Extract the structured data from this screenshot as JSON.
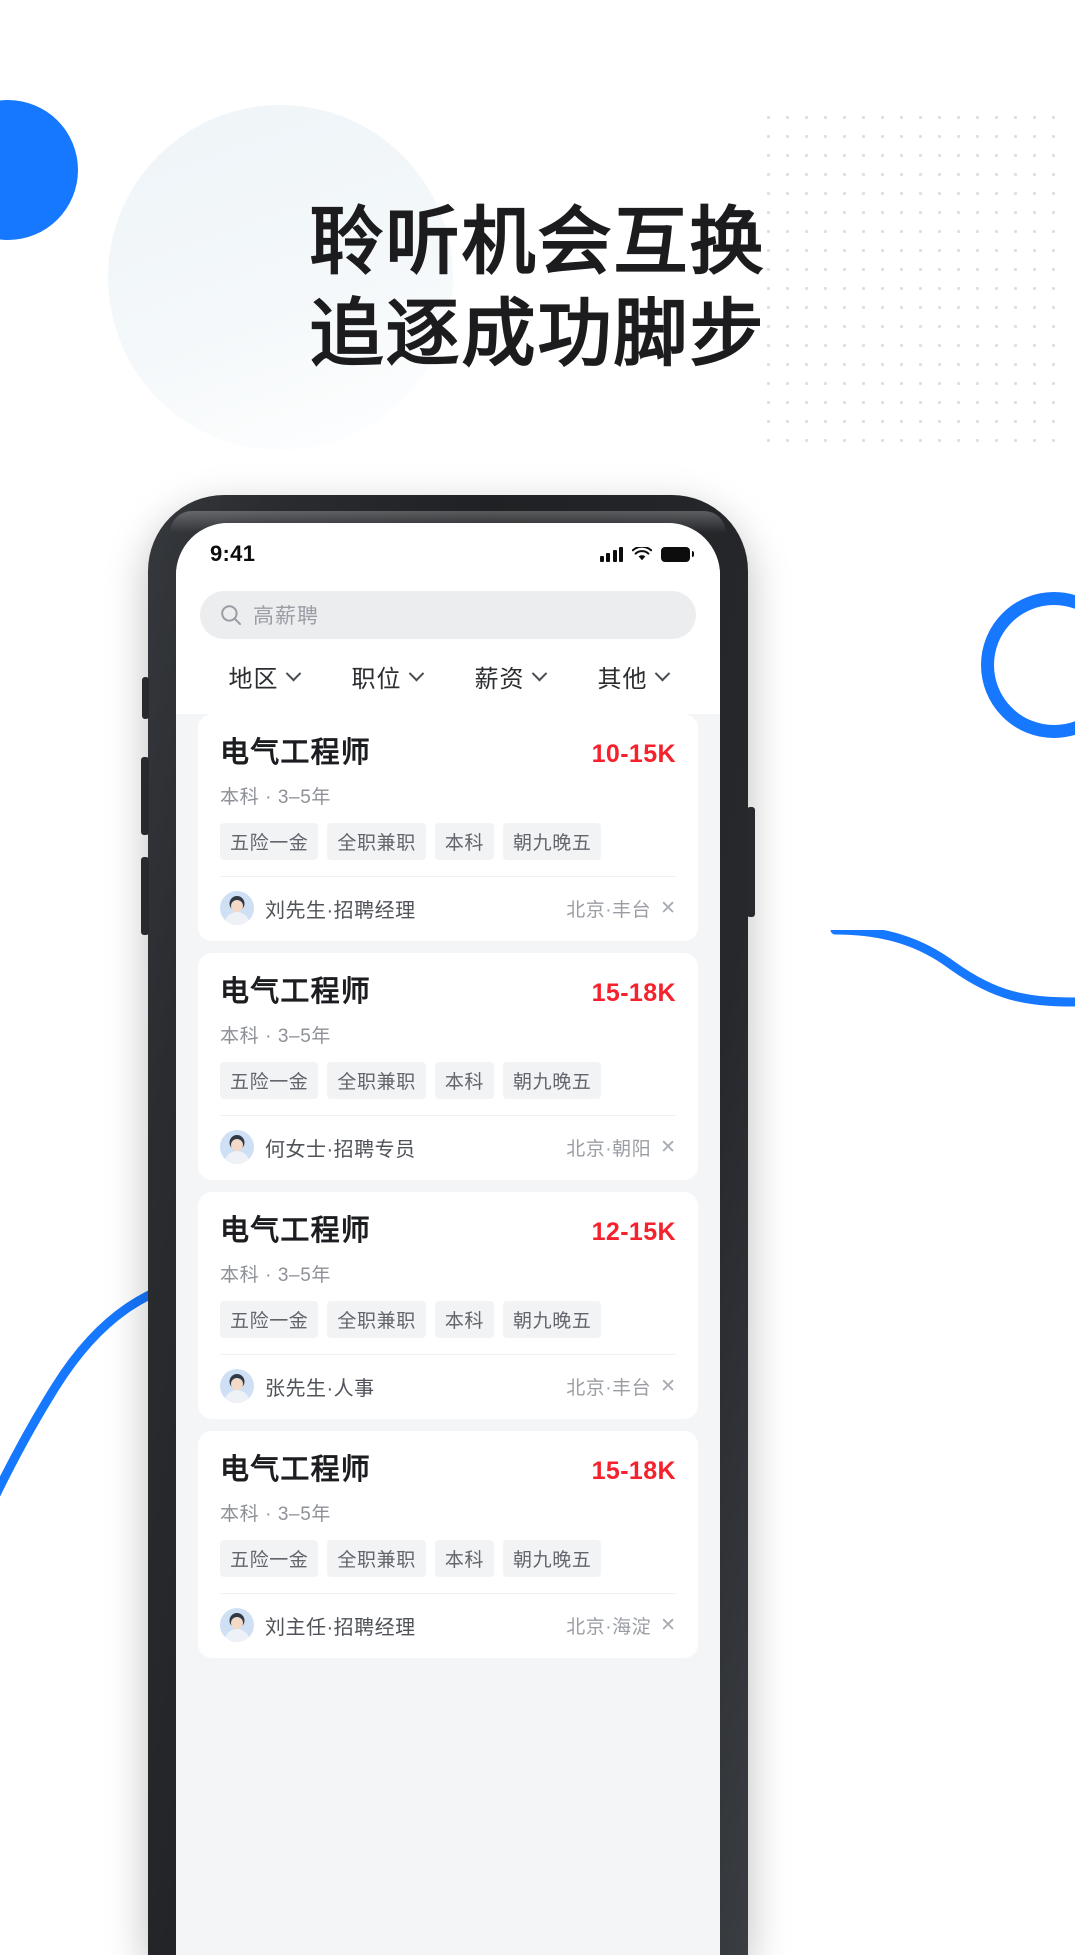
{
  "headline": {
    "line1": "聆听机会互换",
    "line2": "追逐成功脚步"
  },
  "colors": {
    "accent_blue": "#1677ff",
    "salary_red": "#f5222d",
    "text_dark": "#1c1c1e",
    "muted": "#9a9ea4"
  },
  "phone": {
    "statusbar": {
      "time": "9:41",
      "signal_icon": "cellular-signal-icon",
      "wifi_icon": "wifi-icon",
      "battery_icon": "battery-icon"
    },
    "search": {
      "icon": "search-icon",
      "placeholder": "高薪聘",
      "value": ""
    },
    "filters": [
      {
        "label": "地区",
        "icon": "chevron-down-icon"
      },
      {
        "label": "职位",
        "icon": "chevron-down-icon"
      },
      {
        "label": "薪资",
        "icon": "chevron-down-icon"
      },
      {
        "label": "其他",
        "icon": "chevron-down-icon"
      }
    ],
    "jobs": [
      {
        "title": "电气工程师",
        "salary": "10-15K",
        "meta": "本科 · 3–5年",
        "tags": [
          "五险一金",
          "全职兼职",
          "本科",
          "朝九晚五"
        ],
        "recruiter": "刘先生·招聘经理",
        "location": "北京·丰台",
        "close_icon": "close-icon"
      },
      {
        "title": "电气工程师",
        "salary": "15-18K",
        "meta": "本科 · 3–5年",
        "tags": [
          "五险一金",
          "全职兼职",
          "本科",
          "朝九晚五"
        ],
        "recruiter": "何女士·招聘专员",
        "location": "北京·朝阳",
        "close_icon": "close-icon"
      },
      {
        "title": "电气工程师",
        "salary": "12-15K",
        "meta": "本科 · 3–5年",
        "tags": [
          "五险一金",
          "全职兼职",
          "本科",
          "朝九晚五"
        ],
        "recruiter": "张先生·人事",
        "location": "北京·丰台",
        "close_icon": "close-icon"
      },
      {
        "title": "电气工程师",
        "salary": "15-18K",
        "meta": "本科 · 3–5年",
        "tags": [
          "五险一金",
          "全职兼职",
          "本科",
          "朝九晚五"
        ],
        "recruiter": "刘主任·招聘经理",
        "location": "北京·海淀",
        "close_icon": "close-icon"
      }
    ]
  }
}
